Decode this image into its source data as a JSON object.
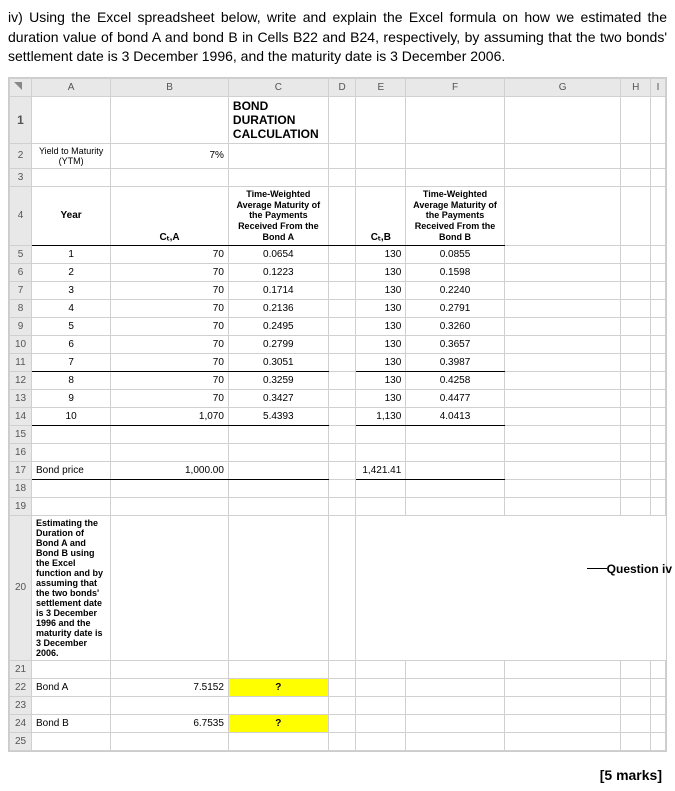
{
  "question": "iv) Using the Excel spreadsheet below, write and explain the Excel formula on how we estimated the duration value of bond A and bond B in Cells B22 and B24, respectively, by assuming that the two bonds' settlement date is 3 December 1996, and the maturity date is 3 December 2006.",
  "columns": [
    "A",
    "B",
    "C",
    "D",
    "E",
    "F",
    "G",
    "H",
    "I"
  ],
  "title": "BOND DURATION CALCULATION",
  "ytm_label": "Yield to Maturity (YTM)",
  "ytm_value": "7%",
  "header_bondA": "Time-Weighted Average Maturity of the Payments Received From the Bond A",
  "header_bondB": "Time-Weighted Average Maturity of the Payments Received From the Bond B",
  "year_label": "Year",
  "cta_label": "Cₜ,A",
  "ctb_label": "Cₜ,B",
  "rows": [
    {
      "r": "5",
      "year": "1",
      "cta": "70",
      "wa": "0.0654",
      "ctb": "130",
      "wb": "0.0855"
    },
    {
      "r": "6",
      "year": "2",
      "cta": "70",
      "wa": "0.1223",
      "ctb": "130",
      "wb": "0.1598"
    },
    {
      "r": "7",
      "year": "3",
      "cta": "70",
      "wa": "0.1714",
      "ctb": "130",
      "wb": "0.2240"
    },
    {
      "r": "8",
      "year": "4",
      "cta": "70",
      "wa": "0.2136",
      "ctb": "130",
      "wb": "0.2791"
    },
    {
      "r": "9",
      "year": "5",
      "cta": "70",
      "wa": "0.2495",
      "ctb": "130",
      "wb": "0.3260"
    },
    {
      "r": "10",
      "year": "6",
      "cta": "70",
      "wa": "0.2799",
      "ctb": "130",
      "wb": "0.3657"
    },
    {
      "r": "11",
      "year": "7",
      "cta": "70",
      "wa": "0.3051",
      "ctb": "130",
      "wb": "0.3987"
    },
    {
      "r": "12",
      "year": "8",
      "cta": "70",
      "wa": "0.3259",
      "ctb": "130",
      "wb": "0.4258"
    },
    {
      "r": "13",
      "year": "9",
      "cta": "70",
      "wa": "0.3427",
      "ctb": "130",
      "wb": "0.4477"
    },
    {
      "r": "14",
      "year": "10",
      "cta": "1,070",
      "wa": "5.4393",
      "ctb": "1,130",
      "wb": "4.0413"
    }
  ],
  "bond_price_label": "Bond price",
  "bond_price_A": "1,000.00",
  "bond_price_B": "1,421.41",
  "note": "Estimating the Duration of Bond A and Bond B using the Excel function and by assuming that the two bonds' settlement date is 3 December 1996 and the maturity date is 3 December 2006.",
  "bondA_label": "Bond A",
  "bondA_value": "7.5152",
  "bondA_formula": "?",
  "bondB_label": "Bond B",
  "bondB_value": "6.7535",
  "bondB_formula": "?",
  "callout": "Question iv",
  "marks": "[5 marks]"
}
